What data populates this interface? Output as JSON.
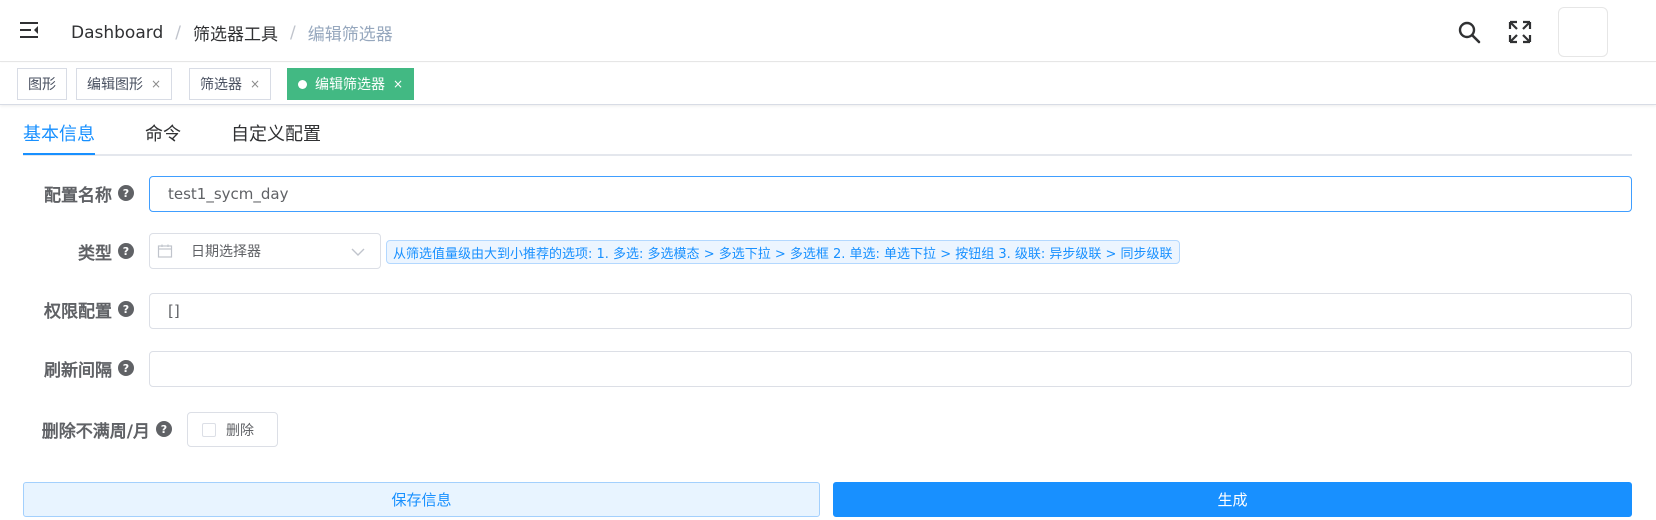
{
  "navbar": {
    "breadcrumb": [
      "Dashboard",
      "筛选器工具",
      "编辑筛选器"
    ],
    "separator": "/",
    "icons": [
      "hamburger-icon",
      "search-icon",
      "fullscreen-icon"
    ]
  },
  "tags": [
    {
      "label": "图形",
      "closable": false,
      "active": false
    },
    {
      "label": "编辑图形",
      "closable": true,
      "active": false
    },
    {
      "label": "筛选器",
      "closable": true,
      "active": false
    },
    {
      "label": "编辑筛选器",
      "closable": true,
      "active": true
    }
  ],
  "tag_close_glyph": "×",
  "tabs": [
    "基本信息",
    "命令",
    "自定义配置"
  ],
  "form": {
    "name_label": "配置名称",
    "name_value": "test1_sycm_day",
    "type_label": "类型",
    "type_value": "日期选择器",
    "type_hint": "从筛选值量级由大到小推荐的选项: 1. 多选: 多选模态 > 多选下拉 > 多选框 2. 单选: 单选下拉 > 按钮组 3. 级联: 异步级联 > 同步级联",
    "permission_label": "权限配置",
    "permission_value": "[]",
    "refresh_label": "刷新间隔",
    "refresh_value": "",
    "remove_label": "删除不满周/月",
    "remove_checkbox_label": "删除",
    "remove_checked": false,
    "help_glyph": "?"
  },
  "buttons": {
    "save": "保存信息",
    "generate": "生成"
  },
  "colors": {
    "primary": "#1890ff",
    "active_tag": "#42b983",
    "breadcrumb_current": "#97a8be"
  }
}
